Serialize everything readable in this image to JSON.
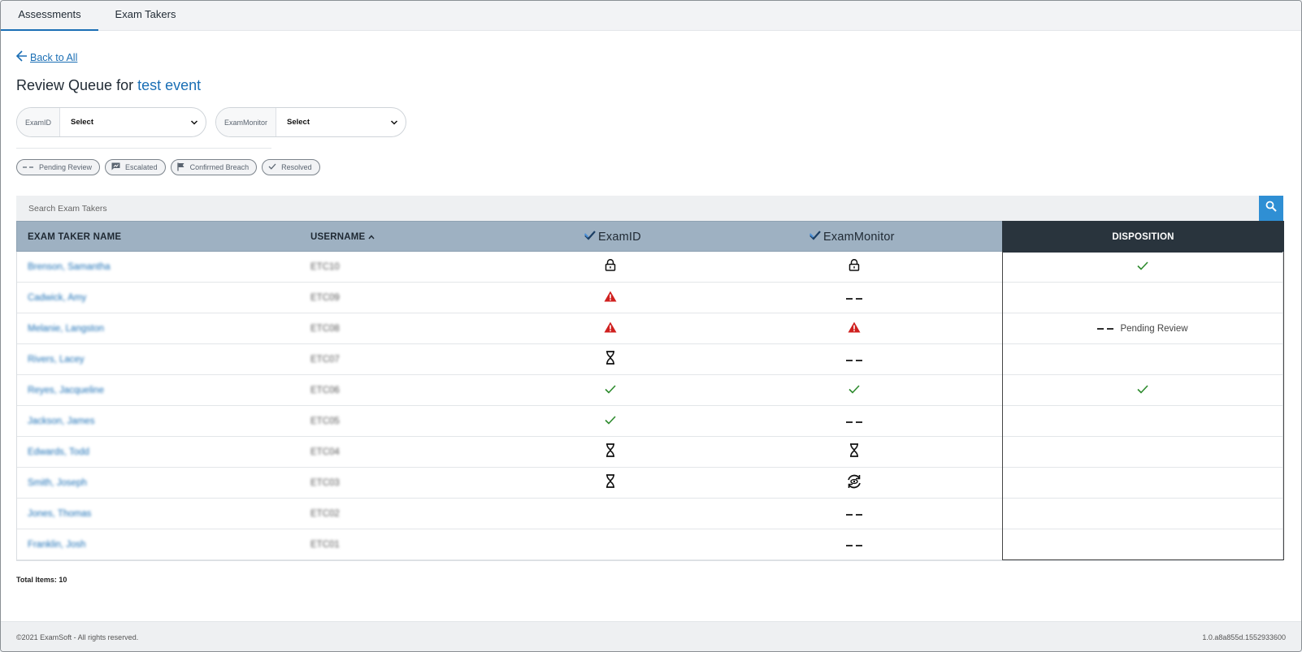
{
  "tabs": [
    {
      "label": "Assessments",
      "active": true
    },
    {
      "label": "Exam Takers",
      "active": false
    }
  ],
  "back_label": "Back to All",
  "title": {
    "prefix": "Review Queue for",
    "event": "test event"
  },
  "filters": [
    {
      "label": "ExamID",
      "value": "Select"
    },
    {
      "label": "ExamMonitor",
      "value": "Select"
    }
  ],
  "legend": [
    {
      "icon": "dash-icon",
      "label": "Pending Review"
    },
    {
      "icon": "escalated-icon",
      "label": "Escalated"
    },
    {
      "icon": "flag-icon",
      "label": "Confirmed Breach"
    },
    {
      "icon": "check-icon",
      "label": "Resolved"
    }
  ],
  "search": {
    "placeholder": "Search Exam Takers"
  },
  "columns": {
    "name": "EXAM TAKER NAME",
    "username": "USERNAME",
    "examid": "ExamID",
    "monitor": "ExamMonitor",
    "disposition": "DISPOSITION"
  },
  "rows": [
    {
      "name": "Brenson, Samantha",
      "username": "ETC10",
      "examid": "lock",
      "monitor": "lock",
      "disposition": "check",
      "disposition_label": ""
    },
    {
      "name": "Cadwick, Amy",
      "username": "ETC09",
      "examid": "warning",
      "monitor": "dash",
      "disposition": "",
      "disposition_label": ""
    },
    {
      "name": "Melanie, Langston",
      "username": "ETC08",
      "examid": "warning",
      "monitor": "warning",
      "disposition": "dash",
      "disposition_label": "Pending Review"
    },
    {
      "name": "Rivers, Lacey",
      "username": "ETC07",
      "examid": "hourglass",
      "monitor": "dash",
      "disposition": "",
      "disposition_label": ""
    },
    {
      "name": "Reyes, Jacqueline",
      "username": "ETC06",
      "examid": "check",
      "monitor": "check",
      "disposition": "check",
      "disposition_label": ""
    },
    {
      "name": "Jackson, James",
      "username": "ETC05",
      "examid": "check",
      "monitor": "dash",
      "disposition": "",
      "disposition_label": ""
    },
    {
      "name": "Edwards, Todd",
      "username": "ETC04",
      "examid": "hourglass",
      "monitor": "hourglass",
      "disposition": "",
      "disposition_label": ""
    },
    {
      "name": "Smith, Joseph",
      "username": "ETC03",
      "examid": "hourglass",
      "monitor": "processing",
      "disposition": "",
      "disposition_label": ""
    },
    {
      "name": "Jones, Thomas",
      "username": "ETC02",
      "examid": "",
      "monitor": "dash",
      "disposition": "",
      "disposition_label": ""
    },
    {
      "name": "Franklin, Josh",
      "username": "ETC01",
      "examid": "",
      "monitor": "dash",
      "disposition": "",
      "disposition_label": ""
    }
  ],
  "total_items": "Total Items: 10",
  "footer": {
    "copyright": "©2021 ExamSoft - All rights reserved.",
    "version": "1.0.a8a855d.1552933600"
  },
  "colors": {
    "accent": "#1b6fb5",
    "header": "#9eb1c2",
    "disposition_header": "#29343d",
    "warning": "#d0201f",
    "success": "#2e8b2e"
  }
}
